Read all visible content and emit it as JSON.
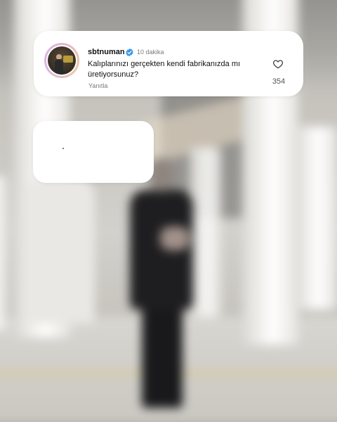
{
  "comment": {
    "username": "sbtnuman",
    "verified_icon": "verified-badge-icon",
    "time": "10 dakika",
    "text": "Kalıplarınızı gerçekten kendi fabrikanızda mı üretiyorsunuz?",
    "reply_label": "Yanıtla",
    "like_icon": "heart-icon",
    "like_count": "354"
  },
  "colors": {
    "verified_blue": "#3897f0",
    "card_bg": "#ffffff"
  }
}
